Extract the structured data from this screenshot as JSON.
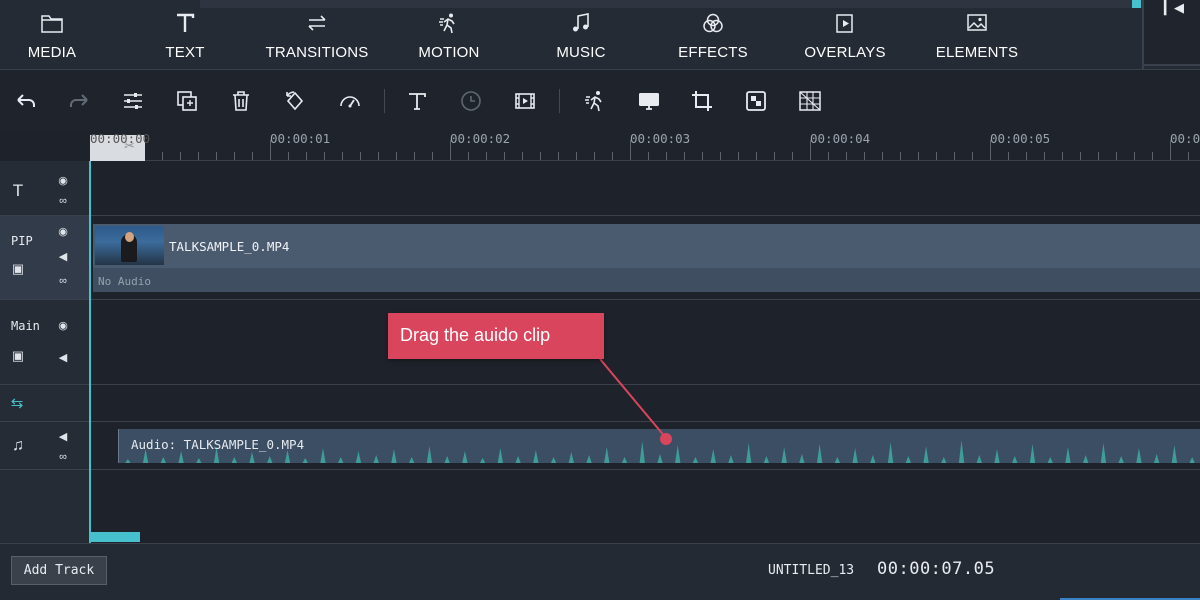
{
  "categories": [
    {
      "label": "MEDIA",
      "icon": "folder-icon"
    },
    {
      "label": "TEXT",
      "icon": "text-icon"
    },
    {
      "label": "TRANSITIONS",
      "icon": "transitions-icon"
    },
    {
      "label": "MOTION",
      "icon": "motion-icon"
    },
    {
      "label": "MUSIC",
      "icon": "music-note-icon"
    },
    {
      "label": "EFFECTS",
      "icon": "effects-icon"
    },
    {
      "label": "OVERLAYS",
      "icon": "overlays-icon"
    },
    {
      "label": "ELEMENTS",
      "icon": "image-icon"
    }
  ],
  "toolbar": {
    "icons": [
      "undo-icon",
      "redo-icon",
      "adjust-icon",
      "copy-icon",
      "delete-icon",
      "rotate-icon",
      "speed-icon",
      "text-icon",
      "duration-icon",
      "freeze-frame-icon",
      "motion-icon",
      "screen-icon",
      "crop-icon",
      "mosaic-icon",
      "grid-icon"
    ]
  },
  "ruler": {
    "playhead_time": "00:00:00",
    "labels": [
      "00:00:01",
      "00:00:02",
      "00:00:03",
      "00:00:04",
      "00:00:05",
      "00:0"
    ]
  },
  "tracks": {
    "text_track": {
      "icon": "text-track-icon"
    },
    "pip": {
      "label": "PIP",
      "clip_title": "TALKSAMPLE_0.MP4",
      "clip_note": "No Audio"
    },
    "main": {
      "label": "Main"
    },
    "transition_track": {
      "icon": "transition-track-icon"
    },
    "audio": {
      "icon": "music-note-icon",
      "clip_title": "Audio: TALKSAMPLE_0.MP4"
    }
  },
  "callout": {
    "text": "Drag the auido clip"
  },
  "bottom": {
    "add_track_label": "Add Track",
    "project_name": "UNTITLED_13",
    "timecode": "00:00:07.05"
  },
  "colors": {
    "accent": "#47c0cd",
    "callout": "#d9455d",
    "waveform": "#3e9d96"
  }
}
